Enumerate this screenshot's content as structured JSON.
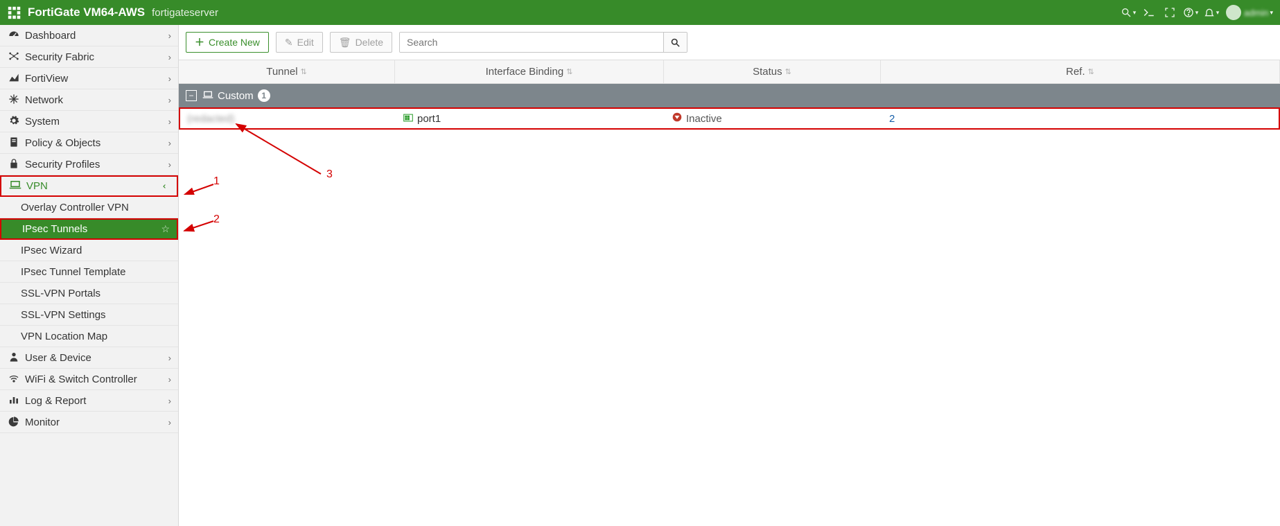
{
  "header": {
    "brand": "FortiGate VM64-AWS",
    "hostname": "fortigateserver",
    "username": "admin"
  },
  "sidebar": {
    "items": [
      {
        "label": "Dashboard"
      },
      {
        "label": "Security Fabric"
      },
      {
        "label": "FortiView"
      },
      {
        "label": "Network"
      },
      {
        "label": "System"
      },
      {
        "label": "Policy & Objects"
      },
      {
        "label": "Security Profiles"
      },
      {
        "label": "VPN"
      },
      {
        "label": "User & Device"
      },
      {
        "label": "WiFi & Switch Controller"
      },
      {
        "label": "Log & Report"
      },
      {
        "label": "Monitor"
      }
    ],
    "vpn_sub": [
      {
        "label": "Overlay Controller VPN"
      },
      {
        "label": "IPsec Tunnels"
      },
      {
        "label": "IPsec Wizard"
      },
      {
        "label": "IPsec Tunnel Template"
      },
      {
        "label": "SSL-VPN Portals"
      },
      {
        "label": "SSL-VPN Settings"
      },
      {
        "label": "VPN Location Map"
      }
    ]
  },
  "toolbar": {
    "create_label": "Create New",
    "edit_label": "Edit",
    "delete_label": "Delete",
    "search_placeholder": "Search"
  },
  "table": {
    "columns": {
      "tunnel": "Tunnel",
      "interface_binding": "Interface Binding",
      "status": "Status",
      "ref": "Ref."
    },
    "group": {
      "label": "Custom",
      "count": "1"
    },
    "rows": [
      {
        "tunnel": "(redacted)",
        "interface": "port1",
        "status": "Inactive",
        "ref": "2"
      }
    ]
  },
  "annotations": {
    "a1": "1",
    "a2": "2",
    "a3": "3"
  }
}
